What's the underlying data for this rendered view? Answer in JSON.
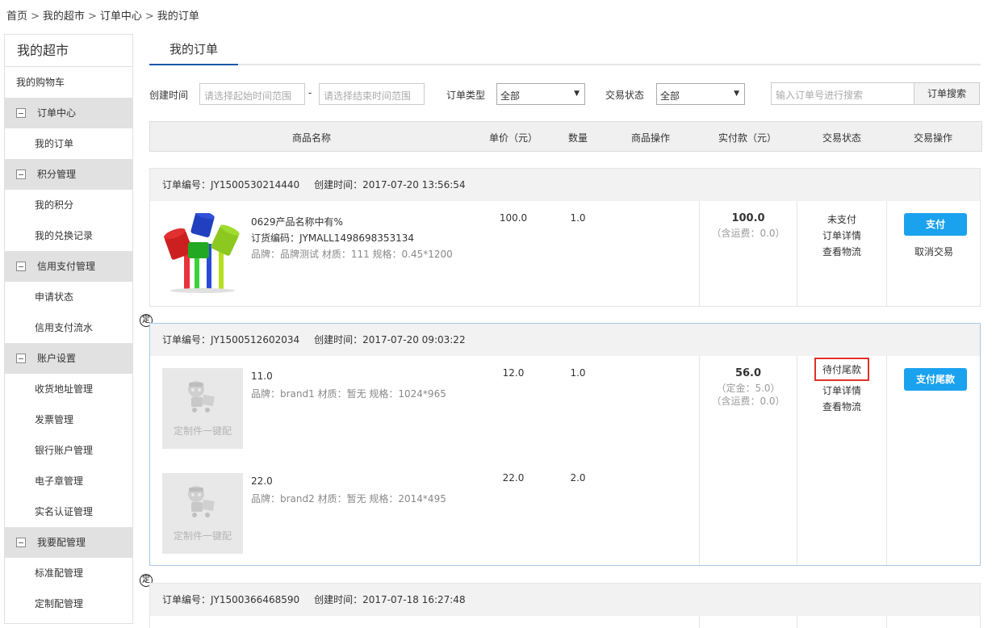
{
  "breadcrumb": [
    "首页",
    "我的超市",
    "订单中心",
    "我的订单"
  ],
  "sidebar": {
    "title": "我的超市",
    "cart": "我的购物车",
    "groups": [
      {
        "label": "订单中心",
        "items": [
          "我的订单"
        ]
      },
      {
        "label": "积分管理",
        "items": [
          "我的积分",
          "我的兑换记录"
        ]
      },
      {
        "label": "信用支付管理",
        "items": [
          "申请状态",
          "信用支付流水"
        ]
      },
      {
        "label": "账户设置",
        "items": [
          "收货地址管理",
          "发票管理",
          "银行账户管理",
          "电子章管理",
          "实名认证管理"
        ]
      },
      {
        "label": "我要配管理",
        "items": [
          "标准配管理",
          "定制配管理"
        ]
      }
    ]
  },
  "tab": {
    "active": "我的订单"
  },
  "filters": {
    "create_time_label": "创建时间",
    "start_placeholder": "请选择起始时间范围",
    "dash": "-",
    "end_placeholder": "请选择结束时间范围",
    "order_type_label": "订单类型",
    "order_type_value": "全部",
    "trade_status_label": "交易状态",
    "trade_status_value": "全部",
    "search_placeholder": "输入订单号进行搜索",
    "search_button": "订单搜索"
  },
  "table": {
    "headers": [
      "商品名称",
      "单价（元）",
      "数量",
      "商品操作",
      "实付款（元）",
      "交易状态",
      "交易操作"
    ]
  },
  "orders": [
    {
      "no_label": "订单编号：JY1500530214440",
      "time_label": "创建时间：2017-07-20 13:56:54",
      "products": [
        {
          "name": "0629产品名称中有%",
          "code": "订货编码：JYMALL1498698353134",
          "meta": "品牌：品牌测试 材质：111 规格：0.45*1200",
          "price": "100.0",
          "qty": "1.0"
        }
      ],
      "paid": "100.0",
      "freight": "（含运费：0.0）",
      "status": [
        "未支付",
        "订单详情",
        "查看物流"
      ],
      "action_button": "支付",
      "cancel": "取消交易"
    },
    {
      "no_label": "订单编号：JY1500512602034",
      "time_label": "创建时间：2017-07-20 09:03:22",
      "products": [
        {
          "name": "11.0",
          "meta": "品牌：brand1 材质：暂无 规格：1024*965",
          "price": "12.0",
          "qty": "1.0",
          "placeholder": "定制件一键配"
        },
        {
          "name": "22.0",
          "meta": "品牌：brand2 材质：暂无 规格：2014*495",
          "price": "22.0",
          "qty": "2.0",
          "placeholder": "定制件一键配"
        }
      ],
      "paid": "56.0",
      "deposit": "（定金：5.0）",
      "freight": "（含运费：0.0）",
      "status": [
        "待付尾款",
        "订单详情",
        "查看物流"
      ],
      "action_button": "支付尾款"
    },
    {
      "no_label": "订单编号：JY1500366468590",
      "time_label": "创建时间：2017-07-18 16:27:48"
    }
  ],
  "marker": "定",
  "colors": {
    "accent_blue": "#1aa2ee",
    "tab_underline": "#1a5aa8",
    "highlight_red": "#e0302a",
    "group_bg": "#e1e1e1"
  }
}
